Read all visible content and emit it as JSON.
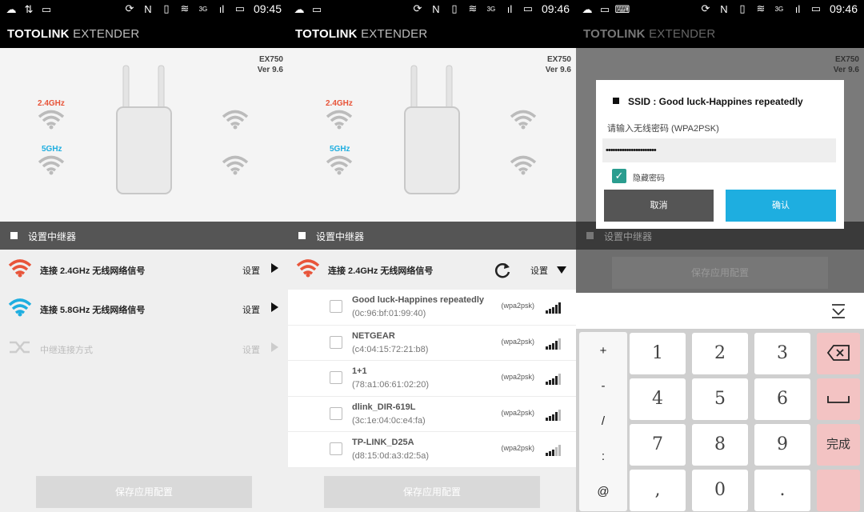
{
  "status": {
    "times": [
      "09:45",
      "09:46",
      "09:46"
    ],
    "signal": "3G"
  },
  "app": {
    "title_bold": "TOTOLINK",
    "title_thin": "EXTENDER"
  },
  "device": {
    "model": "EX750",
    "version": "Ver 9.6"
  },
  "bands": {
    "band_24": "2.4GHz",
    "band_5": "5GHz"
  },
  "colors": {
    "accent_red": "#e8553a",
    "accent_blue": "#1eaee0",
    "dialog_ok": "#1eaee0",
    "checkbox": "#2a9d8f"
  },
  "panel1": {
    "section": "设置中继器",
    "rows": [
      {
        "label": "连接 2.4GHz 无线网络信号",
        "action": "设置",
        "icon": "wifi-red-icon"
      },
      {
        "label": "连接 5.8GHz 无线网络信号",
        "action": "设置",
        "icon": "wifi-blue-icon"
      },
      {
        "label": "中继连接方式",
        "action": "设置",
        "icon": "shuffle-icon"
      }
    ],
    "save": "保存应用配置"
  },
  "panel2": {
    "section": "设置中继器",
    "row_label": "连接 2.4GHz 无线网络信号",
    "row_action": "设置",
    "networks": [
      {
        "name": "Good luck-Happines repeatedly",
        "mac": "(0c:96:bf:01:99:40)",
        "security": "(wpa2psk)",
        "signal": 5
      },
      {
        "name": "NETGEAR",
        "mac": "(c4:04:15:72:21:b8)",
        "security": "(wpa2psk)",
        "signal": 4
      },
      {
        "name": "1+1",
        "mac": "(78:a1:06:61:02:20)",
        "security": "(wpa2psk)",
        "signal": 4
      },
      {
        "name": "dlink_DIR-619L",
        "mac": "(3c:1e:04:0c:e4:fa)",
        "security": "(wpa2psk)",
        "signal": 4
      },
      {
        "name": "TP-LINK_D25A",
        "mac": "(d8:15:0d:a3:d2:5a)",
        "security": "(wpa2psk)",
        "signal": 3
      }
    ],
    "save": "保存应用配置"
  },
  "panel3": {
    "dialog": {
      "title": "SSID : Good luck-Happines repeatedly",
      "prompt": "请输入无线密码 (WPA2PSK)",
      "password": "••••••••••••••••••••••",
      "hide_label": "隐藏密码",
      "cancel": "取消",
      "ok": "确认"
    },
    "section": "设置中继器",
    "save": "保存应用配置",
    "keyboard": {
      "symbols": [
        "+",
        "-",
        "/",
        ":",
        "@"
      ],
      "digits": [
        "1",
        "2",
        "3",
        "4",
        "5",
        "6",
        "7",
        "8",
        "9",
        ",",
        "0",
        "."
      ],
      "done": "完成"
    }
  }
}
